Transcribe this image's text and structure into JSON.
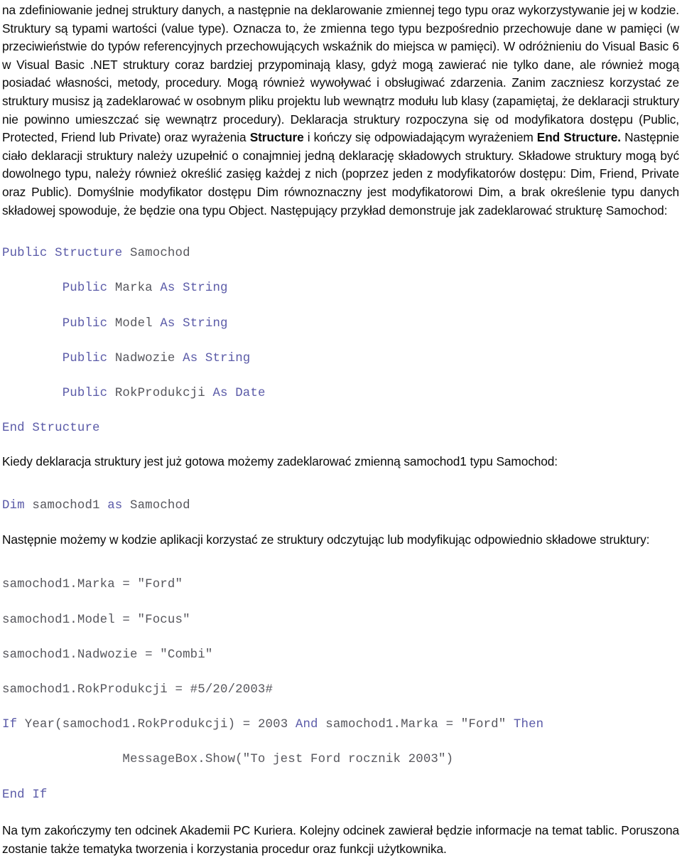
{
  "document": {
    "language": "pl",
    "colors": {
      "text": "#0a0a0a",
      "code_keyword": "#5b5ba8",
      "code_identifier": "#56565c",
      "background": "#ffffff"
    }
  },
  "paragraphs": {
    "intro_part1": "na zdefiniowanie jednej struktury danych, a następnie na deklarowanie zmiennej tego typu oraz wykorzystywanie jej w kodzie. Struktury są typami wartości (value type). Oznacza to, że zmienna tego typu bezpośrednio przechowuje dane w pamięci (w przeciwieństwie do typów referencyjnych przechowujących wskaźnik do miejsca w pamięci). W odróżnieniu do Visual Basic 6 w Visual Basic .NET struktury coraz bardziej przypominają klasy, gdyż mogą zawierać nie tylko dane, ale również mogą posiadać własności, metody, procedury. Mogą również wywoływać i obsługiwać zdarzenia. Zanim zaczniesz korzystać ze struktury musisz ją zadeklarować w osobnym pliku projektu lub wewnątrz modułu lub klasy (zapamiętaj, że deklaracji struktury nie powinno umieszczać się wewnątrz procedury). Deklaracja struktury rozpoczyna się od modyfikatora dostępu (Public, Protected, Friend lub Private) oraz wyrażenia ",
    "intro_bold1": "Structure",
    "intro_part2": " i kończy się odpowiadającym wyrażeniem ",
    "intro_bold2": "End Structure.",
    "intro_part3": " Następnie ciało deklaracji struktury należy uzupełnić o conajmniej jedną deklarację składowych struktury. Składowe struktury mogą być dowolnego typu, należy również określić zasięg każdej z nich (poprzez jeden z modyfikatorów dostępu: Dim, Friend, Private oraz Public). Domyślnie modyfikator dostępu Dim równoznaczny jest modyfikatorowi Dim, a brak określenie typu danych składowej spowoduje, że będzie ona typu Object. Następujący przykład demonstruje jak zadeklarować strukturę Samochod:",
    "after_struct": "Kiedy deklaracja struktury jest już gotowa możemy zadeklarować zmienną samochod1 typu Samochod:",
    "after_dim": "Następnie możemy w kodzie aplikacji korzystać ze struktury odczytując lub modyfikując odpowiednio składowe struktury:",
    "outro": "Na tym zakończymy ten odcinek Akademii PC Kuriera. Kolejny odcinek zawierał będzie informacje na temat tablic. Poruszona zostanie także tematyka tworzenia i korzystania procedur oraz funkcji użytkownika."
  },
  "code_blocks": {
    "structure_declaration": {
      "lines": [
        [
          {
            "t": "Public Structure",
            "c": "kw"
          },
          {
            "t": " Samochod",
            "c": "id"
          }
        ],
        [
          {
            "t": "        ",
            "c": "id"
          },
          {
            "t": "Public",
            "c": "kw"
          },
          {
            "t": " Marka ",
            "c": "id"
          },
          {
            "t": "As String",
            "c": "kw"
          }
        ],
        [
          {
            "t": "        ",
            "c": "id"
          },
          {
            "t": "Public",
            "c": "kw"
          },
          {
            "t": " Model ",
            "c": "id"
          },
          {
            "t": "As String",
            "c": "kw"
          }
        ],
        [
          {
            "t": "        ",
            "c": "id"
          },
          {
            "t": "Public",
            "c": "kw"
          },
          {
            "t": " Nadwozie ",
            "c": "id"
          },
          {
            "t": "As String",
            "c": "kw"
          }
        ],
        [
          {
            "t": "        ",
            "c": "id"
          },
          {
            "t": "Public",
            "c": "kw"
          },
          {
            "t": " RokProdukcji ",
            "c": "id"
          },
          {
            "t": "As Date",
            "c": "kw"
          }
        ],
        [
          {
            "t": "End Structure",
            "c": "kw"
          }
        ]
      ],
      "plain_text": "Public Structure Samochod\n        Public Marka As String\n        Public Model As String\n        Public Nadwozie As String\n        Public RokProdukcji As Date\nEnd Structure"
    },
    "variable_declaration": {
      "lines": [
        [
          {
            "t": "Dim",
            "c": "kw"
          },
          {
            "t": " samochod1 ",
            "c": "id"
          },
          {
            "t": "as",
            "c": "kw"
          },
          {
            "t": " Samochod",
            "c": "id"
          }
        ]
      ],
      "plain_text": "Dim samochod1 as Samochod"
    },
    "usage_example": {
      "lines": [
        [
          {
            "t": "samochod1.Marka = \"Ford\"",
            "c": "id"
          }
        ],
        [
          {
            "t": "samochod1.Model = \"Focus\"",
            "c": "id"
          }
        ],
        [
          {
            "t": "samochod1.Nadwozie = \"Combi\"",
            "c": "id"
          }
        ],
        [
          {
            "t": "samochod1.RokProdukcji = #5/20/2003#",
            "c": "id"
          }
        ],
        [
          {
            "t": "If",
            "c": "kw"
          },
          {
            "t": " Year(samochod1.RokProdukcji) = 2003 ",
            "c": "id"
          },
          {
            "t": "And",
            "c": "kw"
          },
          {
            "t": " samochod1.Marka = \"Ford\" ",
            "c": "id"
          },
          {
            "t": "Then",
            "c": "kw"
          }
        ],
        [
          {
            "t": "                MessageBox.Show(\"To jest Ford rocznik 2003\")",
            "c": "id"
          }
        ],
        [
          {
            "t": "End If",
            "c": "kw"
          }
        ]
      ],
      "plain_text": "samochod1.Marka = \"Ford\"\nsamochod1.Model = \"Focus\"\nsamochod1.Nadwozie = \"Combi\"\nsamochod1.RokProdukcji = #5/20/2003#\nIf Year(samochod1.RokProdukcji) = 2003 And samochod1.Marka = \"Ford\" Then\n                MessageBox.Show(\"To jest Ford rocznik 2003\")\nEnd If"
    }
  }
}
